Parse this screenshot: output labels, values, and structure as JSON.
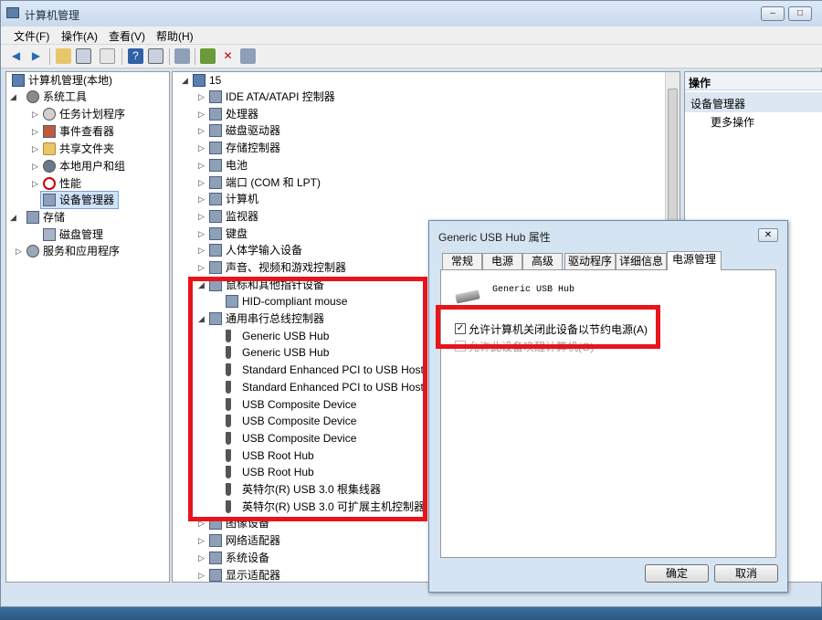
{
  "window": {
    "title": "计算机管理"
  },
  "menu": [
    "文件(F)",
    "操作(A)",
    "查看(V)",
    "帮助(H)"
  ],
  "left_tree": {
    "root": "计算机管理(本地)",
    "system_tools": "系统工具",
    "task_scheduler": "任务计划程序",
    "event_viewer": "事件查看器",
    "shared_folders": "共享文件夹",
    "local_users": "本地用户和组",
    "performance": "性能",
    "device_manager": "设备管理器",
    "storage": "存储",
    "disk_management": "磁盘管理",
    "services": "服务和应用程序"
  },
  "device_tree": {
    "root": "15",
    "categories": [
      "IDE ATA/ATAPI 控制器",
      "处理器",
      "磁盘驱动器",
      "存储控制器",
      "电池",
      "端口 (COM 和 LPT)",
      "计算机",
      "监视器",
      "键盘",
      "人体学输入设备",
      "声音、视频和游戏控制器",
      "鼠标和其他指针设备"
    ],
    "mouse_child": "HID-compliant mouse",
    "usb_category": "通用串行总线控制器",
    "usb_children": [
      "Generic USB Hub",
      "Generic USB Hub",
      "Standard Enhanced PCI to USB Host",
      "Standard Enhanced PCI to USB Host",
      "USB Composite Device",
      "USB Composite Device",
      "USB Composite Device",
      "USB Root Hub",
      "USB Root Hub",
      "英特尔(R) USB 3.0 根集线器",
      "英特尔(R) USB 3.0 可扩展主机控制器"
    ],
    "after_usb": [
      "图像设备",
      "网络适配器",
      "系统设备",
      "显示适配器"
    ]
  },
  "actions": {
    "header": "操作",
    "section": "设备管理器",
    "more": "更多操作"
  },
  "dialog": {
    "title": "Generic USB Hub 属性",
    "close": "✕",
    "tabs": [
      "常规",
      "电源",
      "高级",
      "驱动程序",
      "详细信息",
      "电源管理"
    ],
    "device_name": "Generic USB Hub",
    "allow_off": "允许计算机关闭此设备以节约电源(A)",
    "allow_off_checked": true,
    "allow_wake": "允许此设备唤醒计算机(O)",
    "ok": "确定",
    "cancel": "取消"
  },
  "colors": {
    "highlight": "#e8141c",
    "selection": "#cfe3fa"
  }
}
